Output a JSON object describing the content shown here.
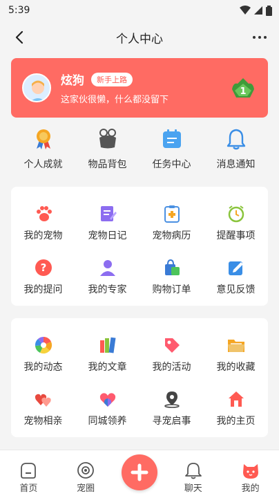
{
  "status_bar": {
    "time": "5:39"
  },
  "nav": {
    "title": "个人中心"
  },
  "profile": {
    "username": "炫狗",
    "badge": "新手上路",
    "bio": "这家伙很懒，什么都没留下",
    "rank": "1"
  },
  "quick_actions": [
    {
      "label": "个人成就",
      "icon": "medal-icon"
    },
    {
      "label": "物品背包",
      "icon": "bag-icon"
    },
    {
      "label": "任务中心",
      "icon": "calendar-icon"
    },
    {
      "label": "消息通知",
      "icon": "bell-icon"
    }
  ],
  "section1": [
    {
      "label": "我的宠物",
      "icon": "paw-icon"
    },
    {
      "label": "宠物日记",
      "icon": "diary-icon"
    },
    {
      "label": "宠物病历",
      "icon": "medical-record-icon"
    },
    {
      "label": "提醒事项",
      "icon": "clock-icon"
    },
    {
      "label": "我的提问",
      "icon": "question-icon"
    },
    {
      "label": "我的专家",
      "icon": "expert-icon"
    },
    {
      "label": "购物订单",
      "icon": "shopping-bag-icon"
    },
    {
      "label": "意见反馈",
      "icon": "feedback-icon"
    }
  ],
  "section2": [
    {
      "label": "我的动态",
      "icon": "aperture-icon"
    },
    {
      "label": "我的文章",
      "icon": "books-icon"
    },
    {
      "label": "我的活动",
      "icon": "tag-icon"
    },
    {
      "label": "我的收藏",
      "icon": "folder-icon"
    },
    {
      "label": "宠物相亲",
      "icon": "hearts-icon"
    },
    {
      "label": "同城领养",
      "icon": "heart-hands-icon"
    },
    {
      "label": "寻宠启事",
      "icon": "location-icon"
    },
    {
      "label": "我的主页",
      "icon": "home-icon"
    }
  ],
  "tabs": [
    {
      "label": "首页",
      "icon": "home-tab-icon"
    },
    {
      "label": "宠圈",
      "icon": "circle-tab-icon"
    },
    {
      "label": "聊天",
      "icon": "chat-tab-icon"
    },
    {
      "label": "我的",
      "icon": "cat-tab-icon"
    }
  ],
  "colors": {
    "accent": "#ff6b63",
    "background": "#f4f4f4"
  }
}
